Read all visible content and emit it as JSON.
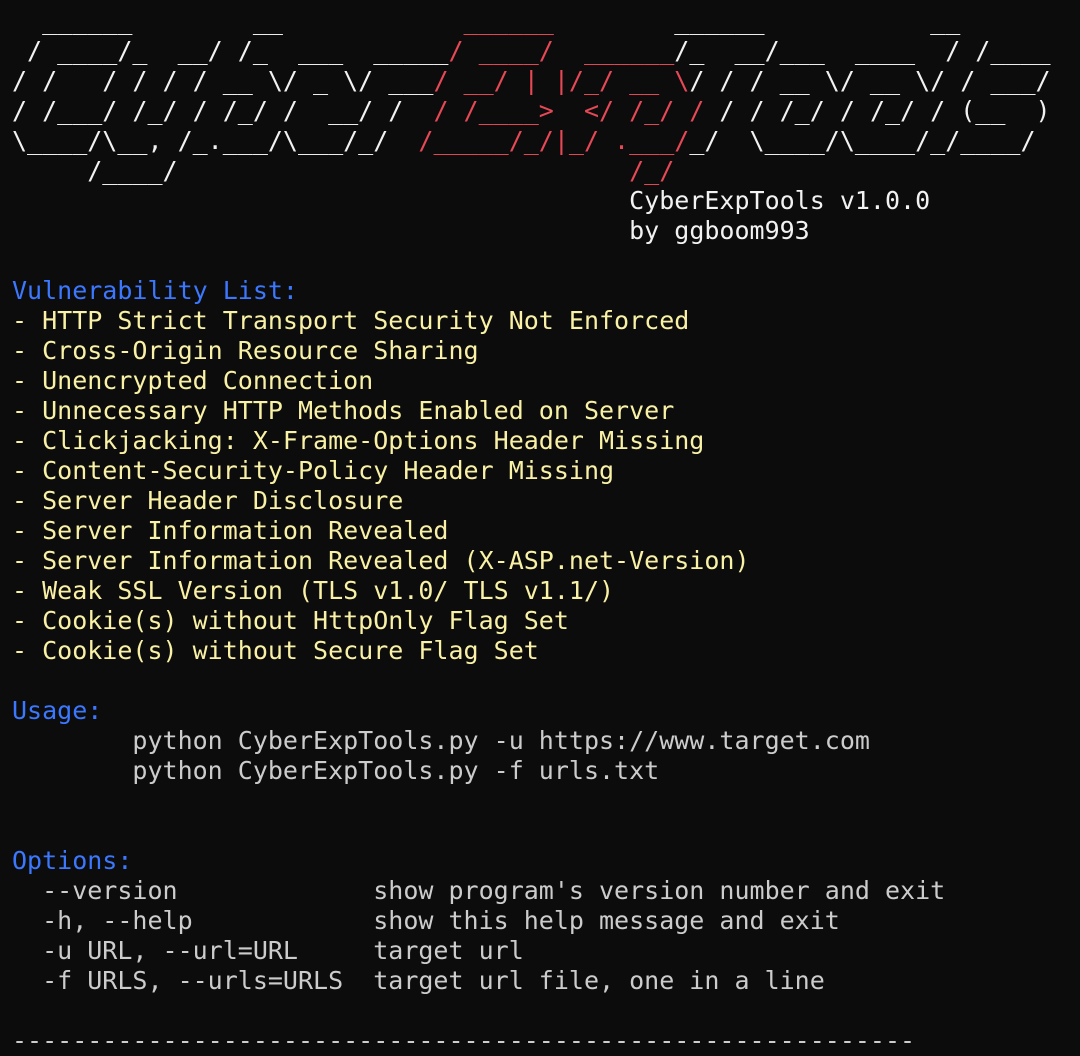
{
  "banner": {
    "lines": [
      [
        "  ______        __            ",
        "______",
        "        ______           __    "
      ],
      [
        " / ____/_  __/ /_  ___  _____",
        "/ ____/  ______",
        "/_  __/___  ____  / /____"
      ],
      [
        "/ /   / / / / __ \\/ _ \\/ ___",
        "/ __/ | |/_/ __ \\",
        "/ / / __ \\/ __ \\/ / ___/"
      ],
      [
        "/ /___/ /_/ / /_/ /  __/ /  ",
        "/ /____>  </ /_/ /",
        " / / /_/ / /_/ / (__  )"
      ],
      [
        "\\____/\\__, /_.___/\\___/_/  ",
        "/_____/_/|_/ .___/",
        "_/  \\____/\\____/_/____/"
      ],
      [
        "     /____/                              ",
        "/_/",
        ""
      ]
    ],
    "tool_name": "CyberExpTools v1.0.0",
    "author": "by ggboom993"
  },
  "vulnerabilities": {
    "heading": "Vulnerability List:",
    "items": [
      "- HTTP Strict Transport Security Not Enforced",
      "- Cross-Origin Resource Sharing",
      "- Unencrypted Connection",
      "- Unnecessary HTTP Methods Enabled on Server",
      "- Clickjacking: X-Frame-Options Header Missing",
      "- Content-Security-Policy Header Missing",
      "- Server Header Disclosure",
      "- Server Information Revealed",
      "- Server Information Revealed (X-ASP.net-Version)",
      "- Weak SSL Version (TLS v1.0/ TLS v1.1/)",
      "- Cookie(s) without HttpOnly Flag Set",
      "- Cookie(s) without Secure Flag Set"
    ]
  },
  "usage": {
    "heading": "Usage:",
    "commands": [
      "        python CyberExpTools.py -u https://www.target.com",
      "        python CyberExpTools.py -f urls.txt"
    ]
  },
  "options": {
    "heading": "Options:",
    "items": [
      "  --version             show program's version number and exit",
      "  -h, --help            show this help message and exit",
      "  -u URL, --url=URL     target url",
      "  -f URLS, --urls=URLS  target url file, one in a line"
    ]
  },
  "footer": {
    "separator": "------------------------------------------------------------"
  },
  "colors": {
    "background": "#0c0c0c",
    "banner": "#f2f2f2",
    "banner_accent": "#e74856",
    "heading": "#3b78ff",
    "list_text": "#f9f1a5",
    "default_text": "#cccccc"
  }
}
